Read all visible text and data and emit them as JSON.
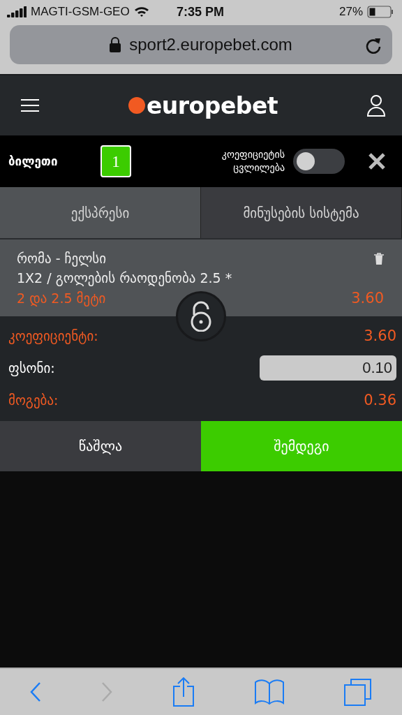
{
  "status_bar": {
    "carrier": "MAGTI-GSM-GEO",
    "time": "7:35 PM",
    "battery": "27%"
  },
  "address_bar": {
    "url": "sport2.europebet.com"
  },
  "header": {
    "logo": "europebet"
  },
  "ticket_bar": {
    "title": "ბილეთი",
    "count": "1",
    "odds_change_label": "კოეფიციეტის ცვლილება",
    "odds_change_on": false
  },
  "tabs": [
    {
      "label": "ექსპრესი",
      "selected": true
    },
    {
      "label": "მინუსების სისტემა",
      "selected": false
    }
  ],
  "bet": {
    "match": "რომა - ჩელსი",
    "market": "1X2 / გოლების რაოდენობა 2.5 *",
    "selection": "2 და 2.5 მეტი",
    "odds": "3.60",
    "locked": false
  },
  "summary": [
    {
      "kind": "text",
      "label": "კოეფიციენტი:",
      "value": "3.60",
      "highlight": true
    },
    {
      "kind": "input",
      "label": "ფსონი:",
      "value": "0.10",
      "highlight": false
    },
    {
      "kind": "text",
      "label": "მოგება:",
      "value": "0.36",
      "highlight": true
    }
  ],
  "buttons": [
    {
      "label": "წაშლა",
      "primary": false
    },
    {
      "label": "შემდეგი",
      "primary": true
    }
  ]
}
